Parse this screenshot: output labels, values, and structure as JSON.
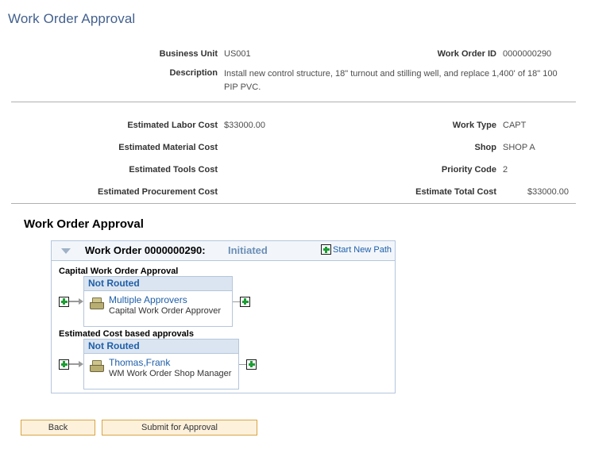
{
  "page": {
    "title": "Work Order Approval"
  },
  "header_fields": {
    "business_unit_label": "Business Unit",
    "business_unit_value": "US001",
    "work_order_id_label": "Work Order ID",
    "work_order_id_value": "0000000290",
    "description_label": "Description",
    "description_value": "Install new control structure, 18\" turnout and stilling well, and replace 1,400' of 18\" 100 PIP PVC.",
    "estimated_labor_cost_label": "Estimated Labor Cost",
    "estimated_labor_cost_value": "$33000.00",
    "estimated_material_cost_label": "Estimated Material Cost",
    "estimated_material_cost_value": "",
    "estimated_tools_cost_label": "Estimated Tools Cost",
    "estimated_tools_cost_value": "",
    "estimated_procurement_cost_label": "Estimated Procurement Cost",
    "estimated_procurement_cost_value": "",
    "work_type_label": "Work Type",
    "work_type_value": "CAPT",
    "shop_label": "Shop",
    "shop_value": "SHOP A",
    "priority_code_label": "Priority Code",
    "priority_code_value": "2",
    "estimate_total_cost_label": "Estimate Total Cost",
    "estimate_total_cost_value": "$33000.00"
  },
  "approval": {
    "section_heading": "Work Order Approval",
    "header_title": "Work Order 0000000290:",
    "header_status": "Initiated",
    "start_new_path_label": "Start New Path",
    "toggle_icon": "chevron-down-icon",
    "paths": [
      {
        "title": "Capital Work Order Approval",
        "status": "Not Routed",
        "approver_name": "Multiple Approvers",
        "approver_role": "Capital Work Order Approver",
        "approver_icon": "inbox-tray-icon",
        "lead_icon": "plus-icon",
        "trail_icon": "plus-icon"
      },
      {
        "title": "Estimated Cost based approvals",
        "status": "Not Routed",
        "approver_name": "Thomas,Frank",
        "approver_role": "WM Work Order Shop Manager",
        "approver_icon": "inbox-tray-icon",
        "lead_icon": "plus-icon",
        "trail_icon": "plus-icon"
      }
    ]
  },
  "buttons": {
    "back_label": "Back",
    "submit_label": "Submit for Approval"
  },
  "colors": {
    "title_blue": "#44618f",
    "link_blue": "#1f5fa8",
    "status_header_bg": "#dbe5f1",
    "panel_border": "#b4c6dc",
    "button_bg": "#fdf1dc",
    "button_border": "#d9a441",
    "plus_green": "#1c9e33"
  }
}
